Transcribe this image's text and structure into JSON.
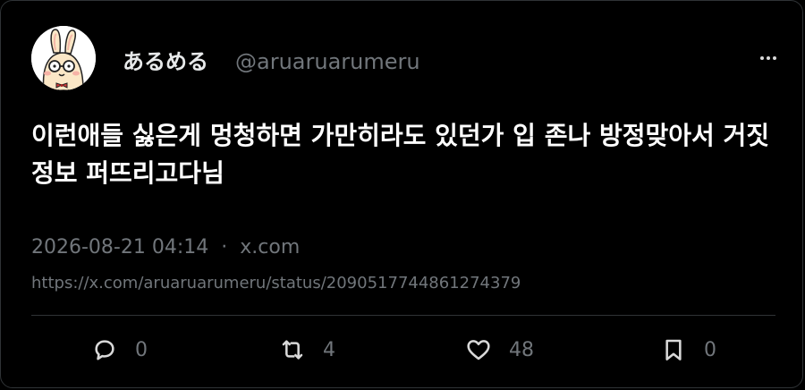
{
  "author": {
    "display_name": "あるめる",
    "handle": "@aruaruarumeru"
  },
  "tweet": {
    "text": "이런애들 싫은게 멍청하면 가만히라도 있던가 입 존나 방정맞아서 거짓정보 퍼뜨리고다님",
    "date": "2026-08-21 04:14",
    "separator": "·",
    "source": "x.com",
    "url": "https://x.com/aruaruarumeru/status/2090517744861274379"
  },
  "stats": {
    "replies": "0",
    "retweets": "4",
    "likes": "48",
    "bookmarks": "0"
  },
  "icons": {
    "avatar": "cartoon-bunny-avatar",
    "more": "more-horizontal-icon",
    "reply": "reply-bubble-icon",
    "retweet": "retweet-icon",
    "like": "heart-icon",
    "bookmark": "bookmark-icon"
  },
  "colors": {
    "background": "#000000",
    "text": "#e7e9ea",
    "muted": "#71767b",
    "border": "#2f3336"
  }
}
